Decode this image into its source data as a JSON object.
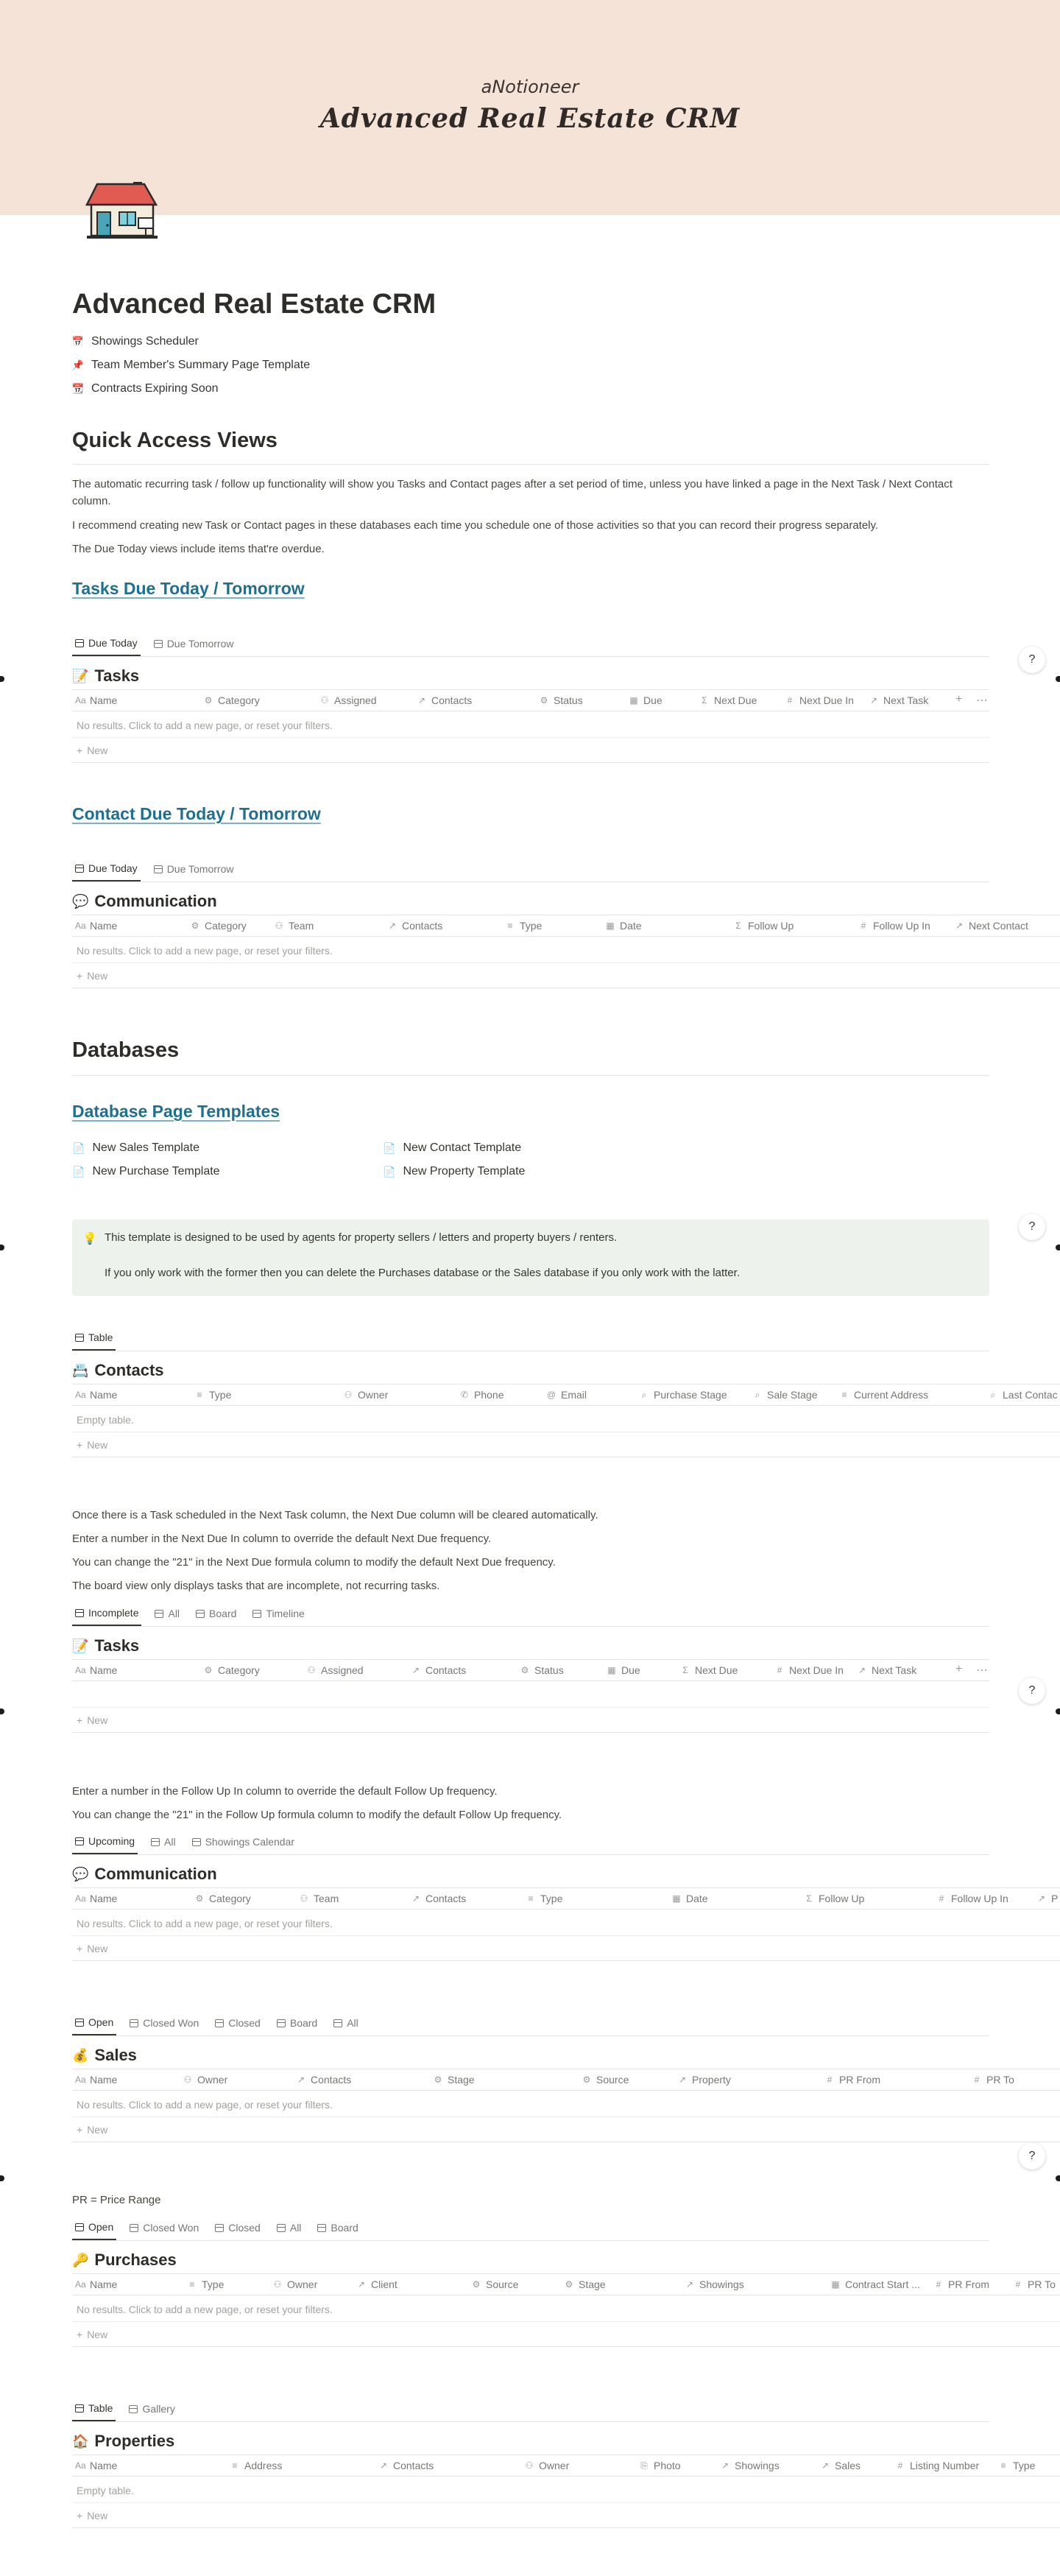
{
  "cover": {
    "brand": "aNotioneer",
    "title": "Advanced Real Estate CRM"
  },
  "page": {
    "title": "Advanced Real Estate CRM",
    "links": [
      {
        "icon": "calendar-icon",
        "glyph": "📅",
        "label": "Showings Scheduler"
      },
      {
        "icon": "pin-icon",
        "glyph": "📌",
        "label": "Team Member's Summary Page Template"
      },
      {
        "icon": "calendar-icon",
        "glyph": "📆",
        "label": "Contracts Expiring Soon"
      }
    ]
  },
  "quick": {
    "heading": "Quick Access Views",
    "p1": "The automatic recurring task / follow up functionality will show you Tasks and Contact pages after a set period of time, unless you have linked a page in the Next Task / Next Contact column.",
    "p2": "I recommend creating new Task or Contact pages in these databases each time you schedule one of those activities so that you can record their progress separately.",
    "p3": "The Due Today views include items that're overdue."
  },
  "tasks_due": {
    "heading": "Tasks Due Today / Tomorrow",
    "views": [
      "Due Today",
      "Due Tomorrow"
    ],
    "db_title": "Tasks",
    "columns": [
      "Name",
      "Category",
      "Assigned",
      "Contacts",
      "Status",
      "Due",
      "Next Due",
      "Next Due In",
      "Next Task"
    ],
    "empty": "No results. Click to add a new page, or reset your filters.",
    "new": "New"
  },
  "contact_due": {
    "heading": "Contact Due Today / Tomorrow",
    "views": [
      "Due Today",
      "Due Tomorrow"
    ],
    "db_title": "Communication",
    "columns": [
      "Name",
      "Category",
      "Team",
      "Contacts",
      "Type",
      "Date",
      "Follow Up",
      "Follow Up In",
      "Next Contact"
    ],
    "empty": "No results. Click to add a new page, or reset your filters.",
    "new": "New"
  },
  "databases": {
    "heading": "Databases",
    "templates_heading": "Database Page Templates",
    "templates": [
      "New Sales Template",
      "New Contact Template",
      "New Purchase Template",
      "New Property Template"
    ]
  },
  "callout": {
    "line1": "This template is designed to be used by agents for property sellers / letters and property buyers / renters.",
    "line2": "If you only work with the former then you can delete the Purchases database or the Sales database if you only work with the latter."
  },
  "contacts": {
    "views": [
      "Table"
    ],
    "db_title": "Contacts",
    "columns": [
      "Name",
      "Type",
      "Owner",
      "Phone",
      "Email",
      "Purchase Stage",
      "Sale Stage",
      "Current Address",
      "Last Contac"
    ],
    "empty": "Empty table.",
    "new": "New"
  },
  "tasks_notes": [
    "Once there is a Task scheduled in the Next Task column, the Next Due column will be cleared automatically.",
    "Enter a number in the Next Due In column to override the default Next Due frequency.",
    "You can change the \"21\" in the Next Due formula column to modify the default Next Due frequency.",
    "The board view only displays tasks that are incomplete, not recurring tasks."
  ],
  "tasks": {
    "views": [
      "Incomplete",
      "All",
      "Board",
      "Timeline"
    ],
    "db_title": "Tasks",
    "columns": [
      "Name",
      "Category",
      "Assigned",
      "Contacts",
      "Status",
      "Due",
      "Next Due",
      "Next Due In",
      "Next Task"
    ],
    "new": "New"
  },
  "comm_notes": [
    "Enter a number in the Follow Up In column to override the default Follow Up frequency.",
    "You can change the \"21\" in the Follow Up formula column to modify the default Follow Up frequency."
  ],
  "communication": {
    "views": [
      "Upcoming",
      "All",
      "Showings Calendar"
    ],
    "db_title": "Communication",
    "columns": [
      "Name",
      "Category",
      "Team",
      "Contacts",
      "Type",
      "Date",
      "Follow Up",
      "Follow Up In",
      "P"
    ],
    "empty": "No results. Click to add a new page, or reset your filters.",
    "new": "New"
  },
  "sales": {
    "views": [
      "Open",
      "Closed Won",
      "Closed",
      "Board",
      "All"
    ],
    "db_title": "Sales",
    "columns": [
      "Name",
      "Owner",
      "Contacts",
      "Stage",
      "Source",
      "Property",
      "PR From",
      "PR To"
    ],
    "empty": "No results. Click to add a new page, or reset your filters.",
    "new": "New"
  },
  "pr_note": "PR = Price Range",
  "purchases": {
    "views": [
      "Open",
      "Closed Won",
      "Closed",
      "All",
      "Board"
    ],
    "db_title": "Purchases",
    "columns": [
      "Name",
      "Type",
      "Owner",
      "Client",
      "Source",
      "Stage",
      "Showings",
      "Contract Start ...",
      "PR From",
      "PR To"
    ],
    "empty": "No results. Click to add a new page, or reset your filters.",
    "new": "New"
  },
  "properties": {
    "views": [
      "Table",
      "Gallery"
    ],
    "db_title": "Properties",
    "columns": [
      "Name",
      "Address",
      "Contacts",
      "Owner",
      "Photo",
      "Showings",
      "Sales",
      "Listing Number",
      "Type"
    ],
    "empty": "Empty table.",
    "new": "New"
  },
  "help_label": "?"
}
